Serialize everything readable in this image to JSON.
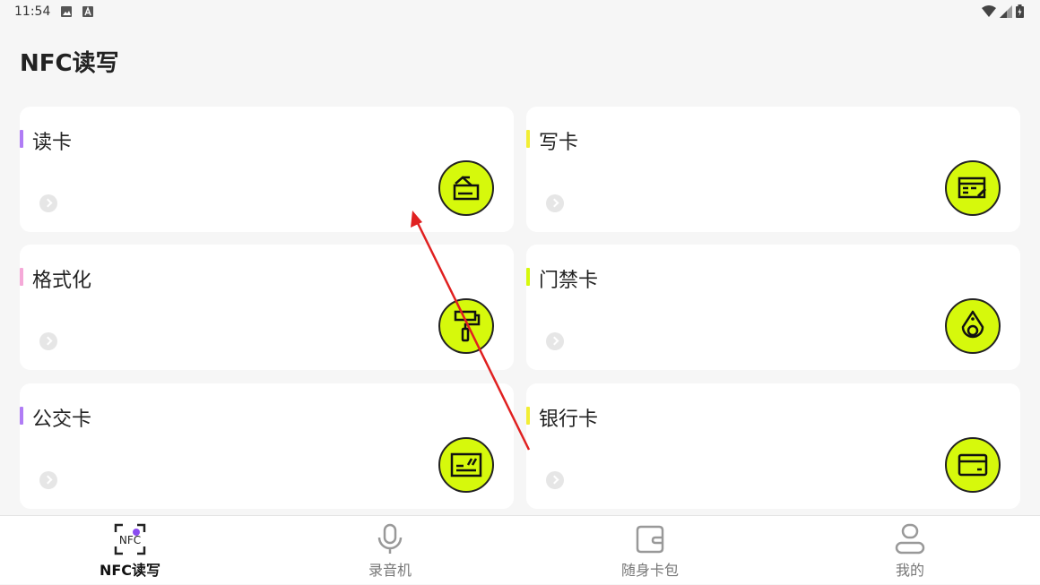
{
  "status": {
    "time": "11:54"
  },
  "header": {
    "title": "NFC读写"
  },
  "cards": [
    {
      "label": "读卡",
      "accent": "#b07cf5",
      "icon": "card-read-icon"
    },
    {
      "label": "写卡",
      "accent": "#f2ee34",
      "icon": "card-write-icon"
    },
    {
      "label": "格式化",
      "accent": "#f5a9d8",
      "icon": "paint-roller-icon"
    },
    {
      "label": "门禁卡",
      "accent": "#d6f90c",
      "icon": "key-fob-icon"
    },
    {
      "label": "公交卡",
      "accent": "#b07cf5",
      "icon": "bus-card-icon"
    },
    {
      "label": "银行卡",
      "accent": "#f2ee34",
      "icon": "bank-card-icon"
    }
  ],
  "nav": [
    {
      "label": "NFC读写",
      "icon": "nfc-scan-icon",
      "active": true
    },
    {
      "label": "录音机",
      "icon": "microphone-icon",
      "active": false
    },
    {
      "label": "随身卡包",
      "icon": "wallet-icon",
      "active": false
    },
    {
      "label": "我的",
      "icon": "user-icon",
      "active": false
    }
  ],
  "colors": {
    "accent_green": "#d6f90c",
    "annotation_arrow": "#e02020"
  }
}
